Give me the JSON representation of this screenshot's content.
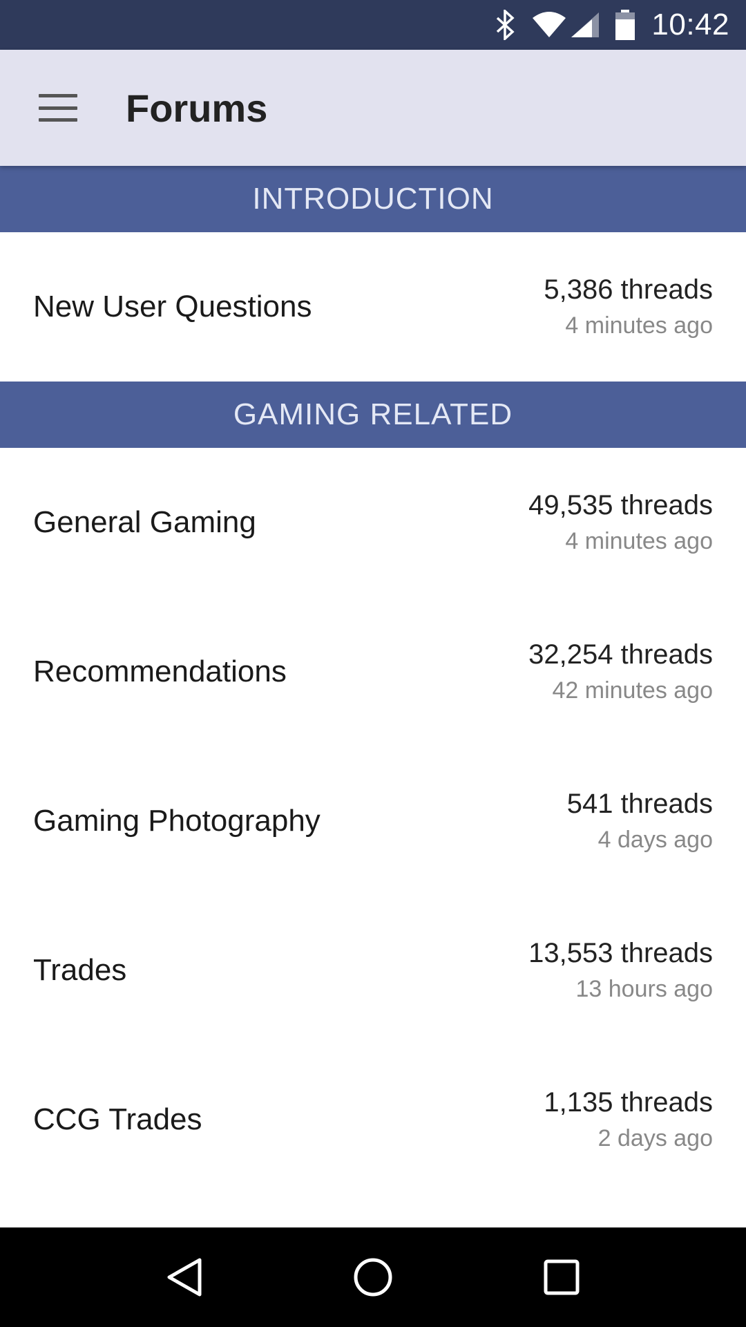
{
  "status_bar": {
    "time": "10:42",
    "icons": [
      "bluetooth-icon",
      "wifi-icon",
      "cell-signal-icon",
      "battery-icon"
    ]
  },
  "app_bar": {
    "title": "Forums",
    "menu_icon": "hamburger-menu-icon"
  },
  "sections": [
    {
      "title": "INTRODUCTION",
      "forums": [
        {
          "name": "New User Questions",
          "threads": "5,386 threads",
          "last_activity": "4 minutes ago"
        }
      ]
    },
    {
      "title": "GAMING RELATED",
      "forums": [
        {
          "name": "General Gaming",
          "threads": "49,535 threads",
          "last_activity": "4 minutes ago"
        },
        {
          "name": "Recommendations",
          "threads": "32,254 threads",
          "last_activity": "42 minutes ago"
        },
        {
          "name": "Gaming Photography",
          "threads": "541 threads",
          "last_activity": "4 days ago"
        },
        {
          "name": "Trades",
          "threads": "13,553 threads",
          "last_activity": "13 hours ago"
        },
        {
          "name": "CCG Trades",
          "threads": "1,135 threads",
          "last_activity": "2 days ago"
        }
      ]
    }
  ],
  "nav_bar": {
    "buttons": [
      "back-icon",
      "home-icon",
      "recents-icon"
    ]
  },
  "colors": {
    "status_bar": "#2f3a5b",
    "app_bar": "#e2e2ef",
    "section_header": "#4c5f98",
    "nav_bar": "#000000"
  }
}
